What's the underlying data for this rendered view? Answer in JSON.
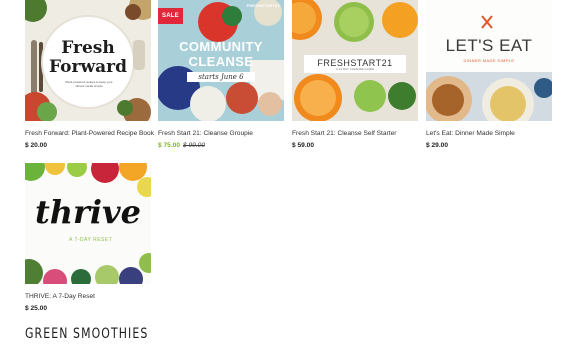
{
  "products": [
    {
      "title": "Fresh Forward: Plant-Powered Recipe Book",
      "price": "$ 20.00",
      "image_text": {
        "line1": "Fresh",
        "line2": "Forward",
        "tagline": "Plant-powered recipes to keep your vibrant meals simple"
      }
    },
    {
      "title": "Fresh Start 21: Cleanse Groupie",
      "sale_badge": "SALE",
      "price": "$ 75.00",
      "old_price": "$ 99.00",
      "image_text": {
        "corner": "FRESHSTART21",
        "line1": "COMMUNITY",
        "line2": "CLEANSE",
        "line3": "starts June 6"
      }
    },
    {
      "title": "Fresh Start 21: Cleanse Self Starter",
      "price": "$ 59.00",
      "image_text": {
        "logo": "FRESHSTART21",
        "tagline": "A 21 DAY CLEANSE GUIDE"
      }
    },
    {
      "title": "Let's Eat: Dinner Made Simple",
      "price": "$ 29.00",
      "image_text": {
        "logo": "LET'S EAT",
        "tagline": "DINNER MADE SIMPLE"
      }
    },
    {
      "title": "THRIVE: A 7-Day Reset",
      "price": "$ 25.00",
      "image_text": {
        "logo": "thrive",
        "tagline": "A 7-DAY RESET"
      }
    }
  ],
  "section": {
    "title": "GREEN SMOOTHIES"
  },
  "colors": {
    "sale_badge": "#e0283a",
    "sale_price": "#7fb32b"
  }
}
